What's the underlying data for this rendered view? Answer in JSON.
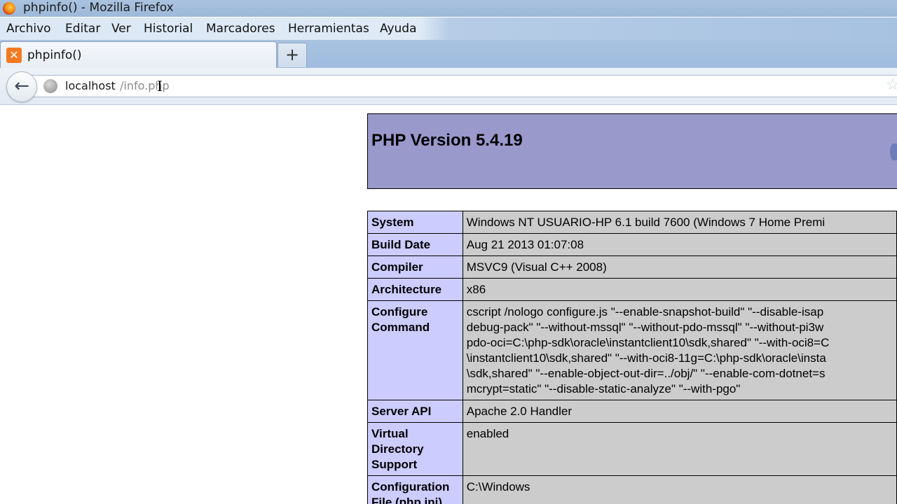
{
  "window": {
    "title": "phpinfo() - Mozilla Firefox"
  },
  "menubar": {
    "items": [
      {
        "label": "Archivo"
      },
      {
        "label": "Editar"
      },
      {
        "label": "Ver"
      },
      {
        "label": "Historial"
      },
      {
        "label": "Marcadores"
      },
      {
        "label": "Herramientas"
      },
      {
        "label": "Ayuda"
      }
    ]
  },
  "tabs": [
    {
      "label": "phpinfo()",
      "favicon": "xampp-icon",
      "active": true
    }
  ],
  "newtab": {
    "label": "+"
  },
  "navbar": {
    "back_icon": "←",
    "url_host": "localhost",
    "url_path": "/info.php",
    "cursor_glyph": "I"
  },
  "page": {
    "header": {
      "version": "PHP Version 5.4.19"
    },
    "rows": [
      {
        "key": "System",
        "value": "Windows NT USUARIO-HP 6.1 build 7600 (Windows 7 Home Premi"
      },
      {
        "key": "Build Date",
        "value": "Aug 21 2013 01:07:08"
      },
      {
        "key": "Compiler",
        "value": "MSVC9 (Visual C++ 2008)"
      },
      {
        "key": "Architecture",
        "value": "x86"
      },
      {
        "key": "Configure Command",
        "value_lines": [
          "cscript /nologo configure.js \"--enable-snapshot-build\" \"--disable-isap",
          "debug-pack\" \"--without-mssql\" \"--without-pdo-mssql\" \"--without-pi3w",
          "pdo-oci=C:\\php-sdk\\oracle\\instantclient10\\sdk,shared\" \"--with-oci8=C",
          "\\instantclient10\\sdk,shared\" \"--with-oci8-11g=C:\\php-sdk\\oracle\\insta",
          "\\sdk,shared\" \"--enable-object-out-dir=../obj/\" \"--enable-com-dotnet=s",
          "mcrypt=static\" \"--disable-static-analyze\" \"--with-pgo\""
        ]
      },
      {
        "key": "Server API",
        "value": "Apache 2.0 Handler"
      },
      {
        "key": "Virtual Directory Support",
        "value": "enabled"
      },
      {
        "key": "Configuration File (php.ini) Path",
        "value": "C:\\Windows"
      }
    ]
  },
  "colors": {
    "header_bg": "#9999cc",
    "key_bg": "#ccccff",
    "value_bg": "#cccccc"
  }
}
